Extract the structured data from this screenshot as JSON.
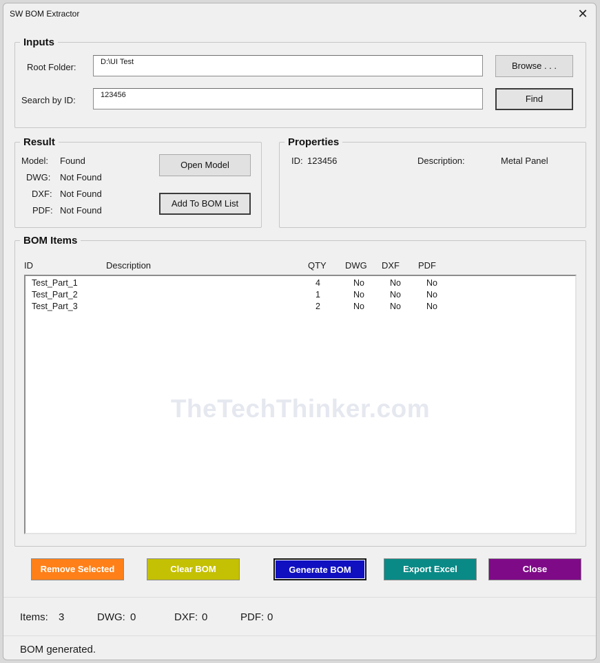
{
  "window": {
    "title": "SW BOM Extractor",
    "close_glyph": "✕"
  },
  "inputs": {
    "legend": "Inputs",
    "root_label": "Root Folder:",
    "root_value": "D:\\UI Test",
    "search_label": "Search by ID:",
    "search_value": "123456",
    "browse_label": "Browse . . .",
    "find_label": "Find"
  },
  "result": {
    "legend": "Result",
    "model_label": "Model:",
    "model_value": "Found",
    "dwg_label": "DWG:",
    "dwg_value": "Not Found",
    "dxf_label": "DXF:",
    "dxf_value": "Not Found",
    "pdf_label": "PDF:",
    "pdf_value": "Not Found",
    "open_model_label": "Open Model",
    "add_bom_label": "Add To BOM List"
  },
  "properties": {
    "legend": "Properties",
    "id_label": "ID:",
    "id_value": "123456",
    "desc_label": "Description:",
    "desc_value": "Metal Panel"
  },
  "bom": {
    "legend": "BOM Items",
    "columns": {
      "id": "ID",
      "description": "Description",
      "qty": "QTY",
      "dwg": "DWG",
      "dxf": "DXF",
      "pdf": "PDF"
    },
    "rows": [
      {
        "id": "Test_Part_1",
        "description": "",
        "qty": "4",
        "dwg": "No",
        "dxf": "No",
        "pdf": "No"
      },
      {
        "id": "Test_Part_2",
        "description": "",
        "qty": "1",
        "dwg": "No",
        "dxf": "No",
        "pdf": "No"
      },
      {
        "id": "Test_Part_3",
        "description": "",
        "qty": "2",
        "dwg": "No",
        "dxf": "No",
        "pdf": "No"
      }
    ],
    "watermark": "TheTechThinker.com"
  },
  "actions": {
    "remove_selected": "Remove Selected",
    "clear_bom": "Clear BOM",
    "generate_bom": "Generate BOM",
    "export_excel": "Export Excel",
    "close": "Close",
    "colors": {
      "remove_selected": "#ff8018",
      "clear_bom": "#c4c004",
      "generate_bom": "#1010c0",
      "export_excel": "#0a8a86",
      "close": "#7f0a88"
    }
  },
  "status": {
    "items_label": "Items:",
    "items_value": "3",
    "dwg_label": "DWG:",
    "dwg_value": "0",
    "dxf_label": "DXF:",
    "dxf_value": "0",
    "pdf_label": "PDF:",
    "pdf_value": "0",
    "message": "BOM generated."
  }
}
